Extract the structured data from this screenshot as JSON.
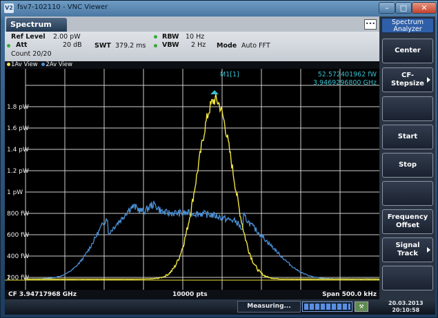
{
  "window": {
    "title": "fsv7-102110 - VNC Viewer",
    "icon_text": "V2",
    "min": "–",
    "max": "□",
    "close": "✕"
  },
  "tab": "Spectrum",
  "dots": "•••",
  "settings": {
    "ref_level_label": "Ref Level",
    "ref_level_value": "2.00 pW",
    "att_label": "Att",
    "att_value": "20 dB",
    "swt_label": "SWT",
    "swt_value": "379.2 ms",
    "rbw_label": "RBW",
    "rbw_value": "10 Hz",
    "vbw_label": "VBW",
    "vbw_value": "2 Hz",
    "mode_label": "Mode",
    "mode_value": "Auto FFT",
    "count": "Count 20/20"
  },
  "traces": {
    "t1": "1Av View",
    "t2": "2Av View",
    "t1_color": "#f2e642",
    "t2_color": "#4a90d6"
  },
  "marker": {
    "label": "M1[1]",
    "value": "52.572401962 fW",
    "freq": "3.9469296800 GHz"
  },
  "y_ticks": [
    "1.8 pW",
    "1.6 pW",
    "1.4 pW",
    "1.2 pW",
    "1 pW",
    "800 fW",
    "600 fW",
    "400 fW",
    "200 fW"
  ],
  "trace_line_label": "1",
  "bottom": {
    "cf": "CF 3.94717968 GHz",
    "pts": "10000 pts",
    "span": "Span 500.0 kHz"
  },
  "status": {
    "measuring": "Measuring...",
    "date": "20.03.2013",
    "time": "20:10:58",
    "icon": "⚒"
  },
  "softkeys": {
    "header": [
      "Spectrum",
      "Analyzer"
    ],
    "items": [
      {
        "label": "Center",
        "arrow": false
      },
      {
        "label": "CF-Stepsize",
        "arrow": true
      },
      {
        "label": "",
        "arrow": false
      },
      {
        "label": "Start",
        "arrow": false
      },
      {
        "label": "Stop",
        "arrow": false
      },
      {
        "label": "",
        "arrow": false
      },
      {
        "label": "Frequency Offset",
        "arrow": false
      },
      {
        "label": "Signal Track",
        "arrow": true
      },
      {
        "label": "",
        "arrow": false
      }
    ]
  },
  "colors": {
    "yellow": "#f2e642",
    "blue": "#4a90d6",
    "marker": "#39c0d0"
  }
}
